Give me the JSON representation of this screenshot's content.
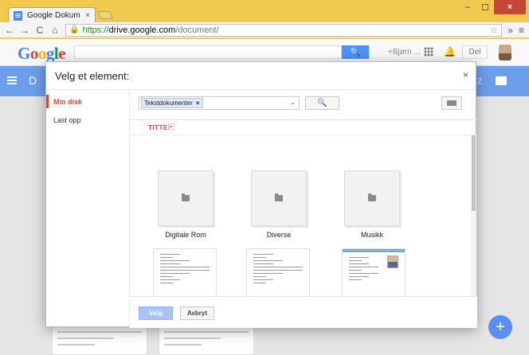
{
  "browser": {
    "tab_title": "Google Dokumenter",
    "tab_close": "×",
    "url_scheme": "https://",
    "url_host": "drive.google.com",
    "url_path": "/document/",
    "nav_back": "←",
    "nav_forward": "→",
    "nav_reload": "C",
    "nav_home": "⌂",
    "star": "☆",
    "more": "»",
    "menu": "≡",
    "win_min": "–",
    "win_max": "☐",
    "win_close": "×"
  },
  "drive": {
    "logo_parts": [
      "G",
      "o",
      "o",
      "g",
      "l",
      "e"
    ],
    "user": "+Bjørn ...",
    "share": "Del",
    "bluebar_letter": "D",
    "bluebar_right": "z",
    "fab": "+"
  },
  "dialog": {
    "title": "Velg et element:",
    "close": "×",
    "sidebar": [
      {
        "label": "Min disk",
        "active": true
      },
      {
        "label": "Last opp",
        "active": false
      }
    ],
    "filter_chip": "Tekstdokumenter",
    "filter_chip_remove": "×",
    "filter_caret": "⌄",
    "search_icon": "🔍",
    "sort_label": "TITTEL",
    "sort_caret": "▾",
    "folders": [
      {
        "name": "Digitale Rom"
      },
      {
        "name": "Diverse"
      },
      {
        "name": "Musikk"
      }
    ],
    "select_button": "Velg",
    "cancel_button": "Avbryt"
  }
}
